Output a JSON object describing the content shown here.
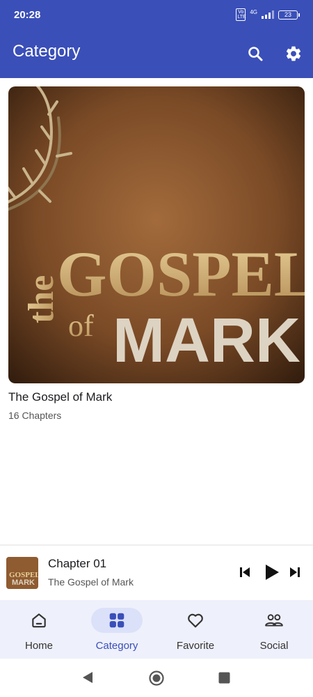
{
  "status_bar": {
    "time": "20:28",
    "volte": "Vo LTE",
    "network": "4G",
    "battery": "23"
  },
  "app_bar": {
    "title": "Category",
    "icons": [
      "search-icon",
      "settings-icon"
    ]
  },
  "category_card": {
    "title": "The Gospel of Mark",
    "subtitle": "16 Chapters",
    "cover_art_text": [
      "the",
      "GOSPEL",
      "of",
      "MARK"
    ]
  },
  "mini_player": {
    "title": "Chapter 01",
    "subtitle": "The Gospel of Mark",
    "controls": [
      "skip-previous-icon",
      "play-icon",
      "skip-next-icon"
    ]
  },
  "bottom_nav": {
    "items": [
      {
        "label": "Home",
        "icon": "home-icon",
        "active": false
      },
      {
        "label": "Category",
        "icon": "category-grid-icon",
        "active": true
      },
      {
        "label": "Favorite",
        "icon": "heart-icon",
        "active": false
      },
      {
        "label": "Social",
        "icon": "people-icon",
        "active": false
      }
    ]
  },
  "colors": {
    "primary": "#3a4fb8",
    "nav_background": "#eef0fb",
    "nav_active_pill": "#dce1fa"
  }
}
